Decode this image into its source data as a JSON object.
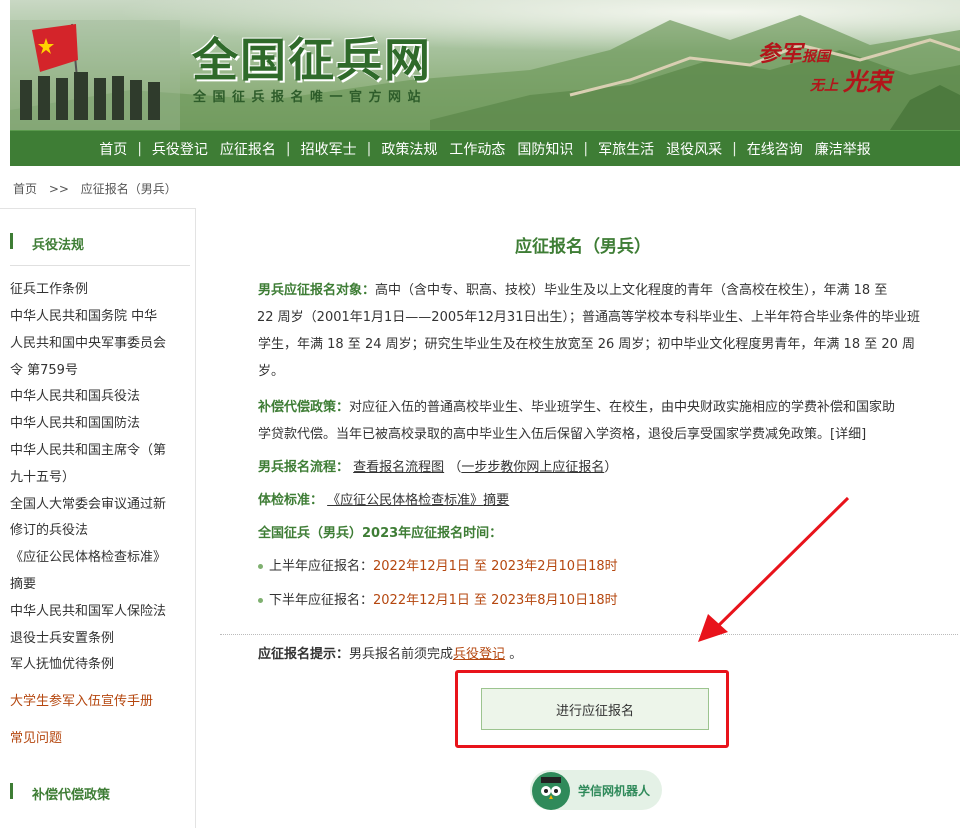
{
  "banner": {
    "title": "全国征兵网",
    "subtitle": "全国征兵报名唯一官方网站",
    "slogan_a": "参军",
    "slogan_b": "报国",
    "slogan_c": "无上",
    "slogan_d": "光荣"
  },
  "nav": {
    "items": [
      "首页",
      "兵役登记",
      "应征报名",
      "招收军士",
      "政策法规",
      "工作动态",
      "国防知识",
      "军旅生活",
      "退役风采",
      "在线咨询",
      "廉洁举报"
    ]
  },
  "breadcrumb": {
    "home": "首页",
    "sep": ">>",
    "current": "应征报名（男兵）"
  },
  "sidebar": {
    "section1": "兵役法规",
    "links": [
      "征兵工作条例",
      "中华人民共和国务院 中华",
      "人民共和国中央军事委员会",
      "令 第759号",
      "中华人民共和国兵役法",
      "中华人民共和国国防法",
      "中华人民共和国主席令（第",
      "九十五号）",
      "全国人大常委会审议通过新",
      "修订的兵役法",
      "《应征公民体格检查标准》",
      "摘要",
      "中华人民共和国军人保险法",
      "退役士兵安置条例",
      "军人抚恤优待条例"
    ],
    "handbook": "大学生参军入伍宣传手册",
    "faq": "常见问题",
    "section2": "补偿代偿政策"
  },
  "main": {
    "title": "应征报名（男兵）",
    "target_label": "男兵应征报名对象：",
    "target_text_1": "高中（含中专、职高、技校）毕业生及以上文化程度的青年（含高校在校生），年满 18 至",
    "target_text_2": "22 周岁（2001年1月1日——2005年12月31日出生）；普通高等学校本专科毕业生、上半年符合毕业条件的毕业班",
    "target_text_3": "学生，年满 18 至 24 周岁；研究生毕业生及在校生放宽至 26 周岁；初中毕业文化程度男青年，年满 18 至 20 周",
    "target_text_4": "岁。",
    "comp_label": "补偿代偿政策：",
    "comp_text_1": "对应征入伍的普通高校毕业生、毕业班学生、在校生，由中央财政实施相应的学费补偿和国家助",
    "comp_text_2": "学贷款代偿。当年已被高校录取的高中毕业生入伍后保留入学资格，退役后享受国家学费减免政策。[详细]",
    "flow_label": "男兵报名流程：",
    "flow_link": "查看报名流程图",
    "flow_link2": "一步步教你网上应征报名",
    "flow_paren_open": "（",
    "flow_paren_close": "）",
    "physical_label": "体检标准：",
    "physical_link": "《应征公民体格检查标准》",
    "physical_suffix": "摘要",
    "time_label": "全国征兵（男兵）2023年应征报名时间：",
    "first_half_label": "上半年应征报名：",
    "first_half_value": "2022年12月1日 至 2023年2月10日18时",
    "second_half_label": "下半年应征报名：",
    "second_half_value": "2022年12月1日 至 2023年8月10日18时",
    "tip_label": "应征报名提示：",
    "tip_text": "男兵报名前须完成",
    "tip_link": "兵役登记",
    "tip_end": "。",
    "apply_button": "进行应征报名",
    "robot_label": "学信网机器人"
  },
  "colors": {
    "brand_green": "#3e7d35",
    "highlight_red": "#e8131b",
    "link_orange": "#b5470f"
  }
}
